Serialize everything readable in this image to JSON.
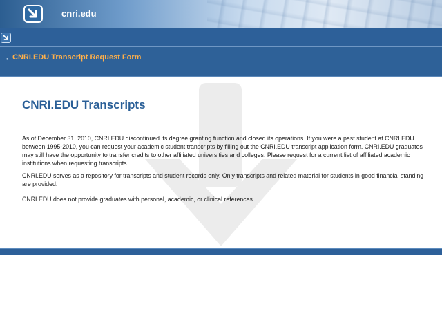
{
  "header": {
    "brand": "cnri.edu",
    "logo_icon": "arrow-down-right-icon"
  },
  "toolbar": {
    "icon": "arrow-down-right-icon"
  },
  "nav": {
    "items": [
      {
        "label": "CNRI.EDU Transcript Request Form"
      }
    ]
  },
  "main": {
    "title": "CNRI.EDU Transcripts",
    "paragraphs": [
      "As of December 31, 2010, CNRI.EDU discontinued its degree granting function and closed its operations. If you were a past student at CNRI.EDU between 1995-2010, you can request your academic student transcripts by filling out the CNRI.EDU transcript application form. CNRI.EDU graduates may still have the opportunity to transfer credits to other affiliated universities and colleges. Please request for a current list of affiliated academic institutions when requesting transcripts.",
      "CNRI.EDU serves as a repository for transcripts and student records only. Only transcripts and related material for students in good financial standing are provided.",
      "CNRI.EDU does not provide graduates with personal, academic, or clinical references."
    ]
  },
  "colors": {
    "header_blue": "#2d6099",
    "title_blue": "#2a5f97",
    "link_orange": "#ffb04a"
  }
}
